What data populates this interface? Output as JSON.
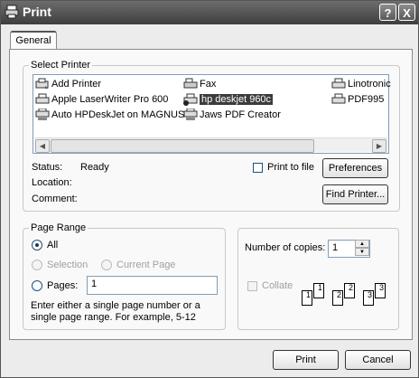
{
  "window": {
    "title": "Print",
    "help_button": "?",
    "close_button": "X"
  },
  "tabs": [
    {
      "label": "General",
      "active": true
    }
  ],
  "select_printer": {
    "legend": "Select Printer",
    "printers": [
      {
        "name": "Add Printer",
        "icon": "add-printer-icon",
        "selected": false
      },
      {
        "name": "Apple LaserWriter Pro 600",
        "icon": "printer-icon",
        "selected": false
      },
      {
        "name": "Auto HPDeskJet on MAGNUS",
        "icon": "network-printer-icon",
        "selected": false
      },
      {
        "name": "Fax",
        "icon": "fax-icon",
        "selected": false
      },
      {
        "name": "hp deskjet 960c",
        "icon": "default-printer-icon",
        "selected": true
      },
      {
        "name": "Jaws PDF Creator",
        "icon": "network-printer-icon",
        "selected": false
      },
      {
        "name": "Linotronic",
        "icon": "printer-icon",
        "selected": false
      },
      {
        "name": "PDF995",
        "icon": "printer-icon",
        "selected": false
      }
    ],
    "status_label": "Status:",
    "status_value": "Ready",
    "location_label": "Location:",
    "location_value": "",
    "comment_label": "Comment:",
    "comment_value": "",
    "print_to_file_label": "Print to file",
    "print_to_file_checked": false,
    "preferences_button": "Preferences",
    "find_printer_button": "Find Printer..."
  },
  "page_range": {
    "legend": "Page Range",
    "options": [
      {
        "label": "All",
        "checked": true,
        "enabled": true
      },
      {
        "label": "Selection",
        "checked": false,
        "enabled": false
      },
      {
        "label": "Current Page",
        "checked": false,
        "enabled": false
      },
      {
        "label": "Pages:",
        "checked": false,
        "enabled": true
      }
    ],
    "pages_value": "1",
    "help_text": "Enter either a single page number or a single page range.  For example, 5-12"
  },
  "copies": {
    "label": "Number of copies:",
    "value": "1",
    "collate_label": "Collate",
    "collate_checked": false,
    "collate_enabled": false,
    "collate_pages": [
      "1",
      "1",
      "2",
      "2",
      "3",
      "3"
    ]
  },
  "buttons": {
    "print": "Print",
    "cancel": "Cancel"
  },
  "colors": {
    "titlebar": "#4a4a4a",
    "selection": "#3c3c3c"
  }
}
